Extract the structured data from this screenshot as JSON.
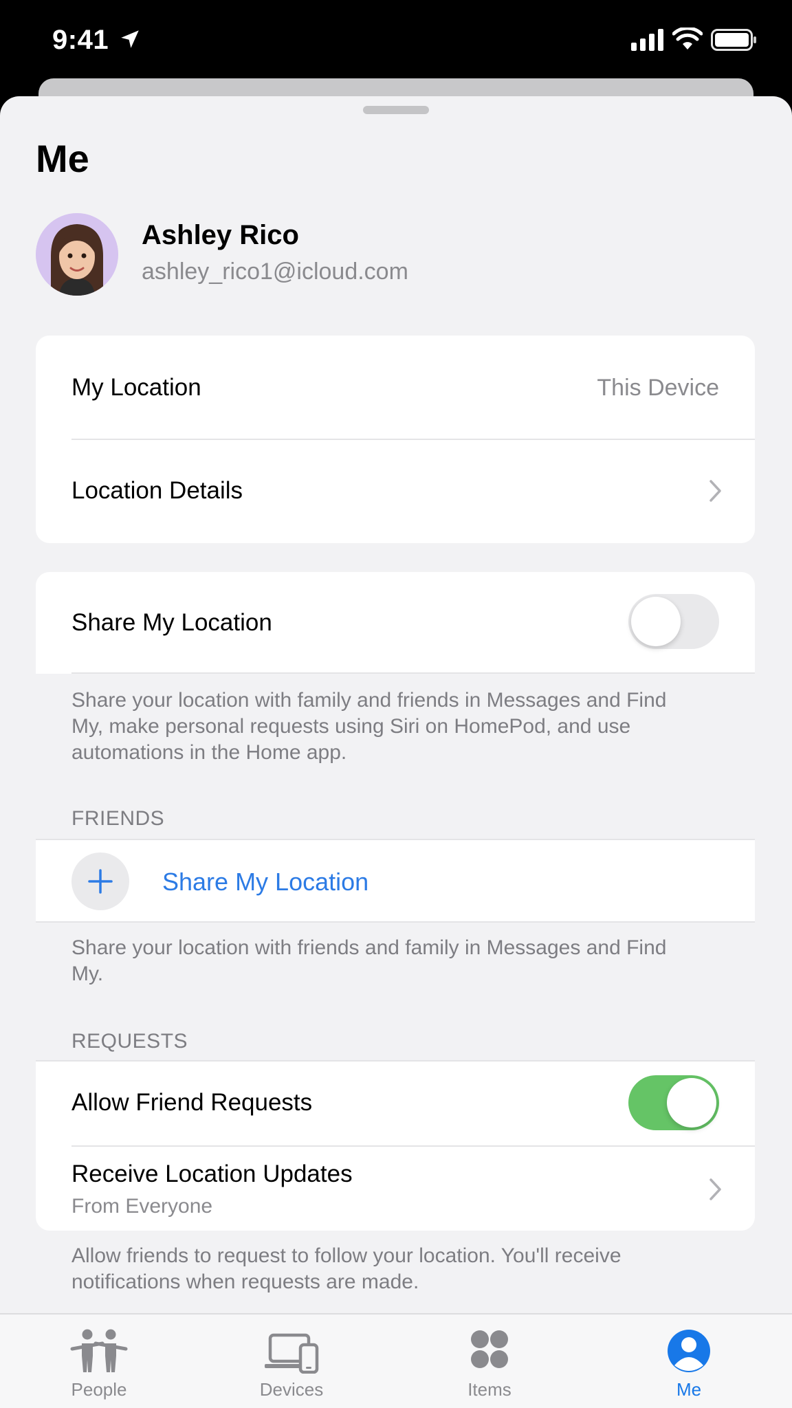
{
  "status_bar": {
    "time": "9:41"
  },
  "page": {
    "title": "Me"
  },
  "profile": {
    "name": "Ashley Rico",
    "email": "ashley_rico1@icloud.com"
  },
  "location_card": {
    "my_location_label": "My Location",
    "my_location_value": "This Device",
    "location_details_label": "Location Details"
  },
  "share_section": {
    "share_label": "Share My Location",
    "share_toggle_on": false,
    "share_footnote": "Share your location with family and friends in Messages and Find My, make personal requests using Siri on HomePod, and use automations in the Home app."
  },
  "friends_section": {
    "header": "FRIENDS",
    "add_label": "Share My Location",
    "footnote": "Share your location with friends and family in Messages and Find My."
  },
  "requests_section": {
    "header": "REQUESTS",
    "allow_label": "Allow Friend Requests",
    "allow_toggle_on": true,
    "receive_label": "Receive Location Updates",
    "receive_sub": "From Everyone",
    "footnote": "Allow friends to request to follow your location. You'll receive notifications when requests are made."
  },
  "tabs": [
    {
      "label": "People",
      "icon": "people-icon"
    },
    {
      "label": "Devices",
      "icon": "devices-icon"
    },
    {
      "label": "Items",
      "icon": "items-icon"
    },
    {
      "label": "Me",
      "icon": "me-icon",
      "active": true
    }
  ],
  "colors": {
    "accent": "#1878e8",
    "toggle_on": "#65c466",
    "link": "#2c7be5"
  }
}
